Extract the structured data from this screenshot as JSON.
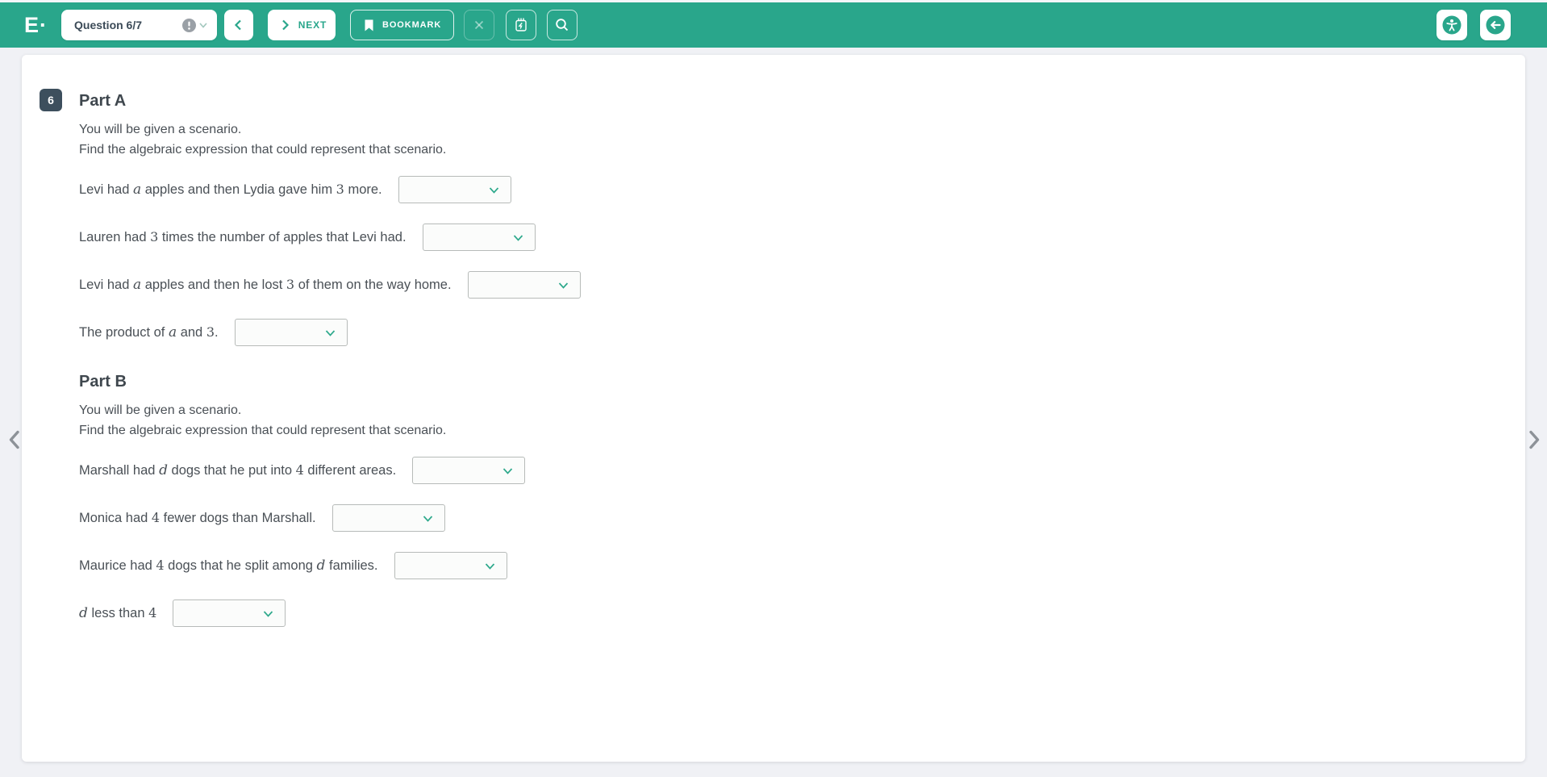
{
  "header": {
    "logo_text": "E·",
    "question_selector": {
      "label": "Question 6/7",
      "alert_icon": "exclamation-circle",
      "expand_icon": "chevron-down"
    },
    "prev_button": {
      "icon": "chevron-left"
    },
    "next_button": {
      "label": "NEXT",
      "icon": "chevron-right"
    },
    "bookmark_button": {
      "label": "BOOKMARK",
      "icon": "bookmark"
    },
    "close_button": {
      "icon": "x-mark",
      "state": "disabled"
    },
    "calculator_button": {
      "icon": "calculator"
    },
    "magnifier_button": {
      "icon": "magnifier"
    },
    "accessibility_button": {
      "icon": "accessibility-person"
    },
    "exit_button": {
      "icon": "arrow-left-circle"
    }
  },
  "colors": {
    "appbar_teal": "#29a68b",
    "badge_slate": "#3d4f5d",
    "body_text": "#4a5056",
    "title_text": "#3f474e",
    "page_background": "#f0f1f5",
    "dropdown_border": "#b7bbb9",
    "dropdown_chevron_teal": "#2ea98c",
    "side_chevron_gray": "#8d9298"
  },
  "main": {
    "question_number": "6",
    "parts": [
      {
        "title": "Part A",
        "instructions": [
          "You will be given a scenario.",
          "Find the algebraic expression that could represent that scenario."
        ],
        "rows": [
          {
            "segments": [
              {
                "k": "t",
                "t": "Levi had "
              },
              {
                "k": "v",
                "t": "a"
              },
              {
                "k": "t",
                "t": " apples and then Lydia gave him "
              },
              {
                "k": "n",
                "t": "3"
              },
              {
                "k": "t",
                "t": " more."
              }
            ],
            "dropdown": {
              "value": ""
            }
          },
          {
            "segments": [
              {
                "k": "t",
                "t": "Lauren had "
              },
              {
                "k": "n",
                "t": "3"
              },
              {
                "k": "t",
                "t": " times the number of apples that Levi had."
              }
            ],
            "dropdown": {
              "value": ""
            }
          },
          {
            "segments": [
              {
                "k": "t",
                "t": "Levi had "
              },
              {
                "k": "v",
                "t": "a"
              },
              {
                "k": "t",
                "t": " apples and then he lost "
              },
              {
                "k": "n",
                "t": "3"
              },
              {
                "k": "t",
                "t": " of them on the way home."
              }
            ],
            "dropdown": {
              "value": ""
            }
          },
          {
            "segments": [
              {
                "k": "t",
                "t": "The product of "
              },
              {
                "k": "v",
                "t": "a"
              },
              {
                "k": "t",
                "t": " and "
              },
              {
                "k": "n",
                "t": "3"
              },
              {
                "k": "t",
                "t": "."
              }
            ],
            "dropdown": {
              "value": ""
            }
          }
        ]
      },
      {
        "title": "Part B",
        "instructions": [
          "You will be given a scenario.",
          "Find the algebraic expression that could represent that scenario."
        ],
        "rows": [
          {
            "segments": [
              {
                "k": "t",
                "t": "Marshall had "
              },
              {
                "k": "v",
                "t": "d"
              },
              {
                "k": "t",
                "t": " dogs that he put into "
              },
              {
                "k": "n",
                "t": "4"
              },
              {
                "k": "t",
                "t": " different areas."
              }
            ],
            "dropdown": {
              "value": ""
            }
          },
          {
            "segments": [
              {
                "k": "t",
                "t": "Monica had "
              },
              {
                "k": "n",
                "t": "4"
              },
              {
                "k": "t",
                "t": " fewer dogs than Marshall."
              }
            ],
            "dropdown": {
              "value": ""
            }
          },
          {
            "segments": [
              {
                "k": "t",
                "t": "Maurice had "
              },
              {
                "k": "n",
                "t": "4"
              },
              {
                "k": "t",
                "t": " dogs that he split among "
              },
              {
                "k": "v",
                "t": "d"
              },
              {
                "k": "t",
                "t": " families."
              }
            ],
            "dropdown": {
              "value": ""
            }
          },
          {
            "segments": [
              {
                "k": "v",
                "t": "d"
              },
              {
                "k": "t",
                "t": " less than "
              },
              {
                "k": "n",
                "t": "4"
              }
            ],
            "dropdown": {
              "value": ""
            }
          }
        ]
      }
    ]
  },
  "pagination": {
    "left_icon": "chevron-left",
    "right_icon": "chevron-right"
  }
}
